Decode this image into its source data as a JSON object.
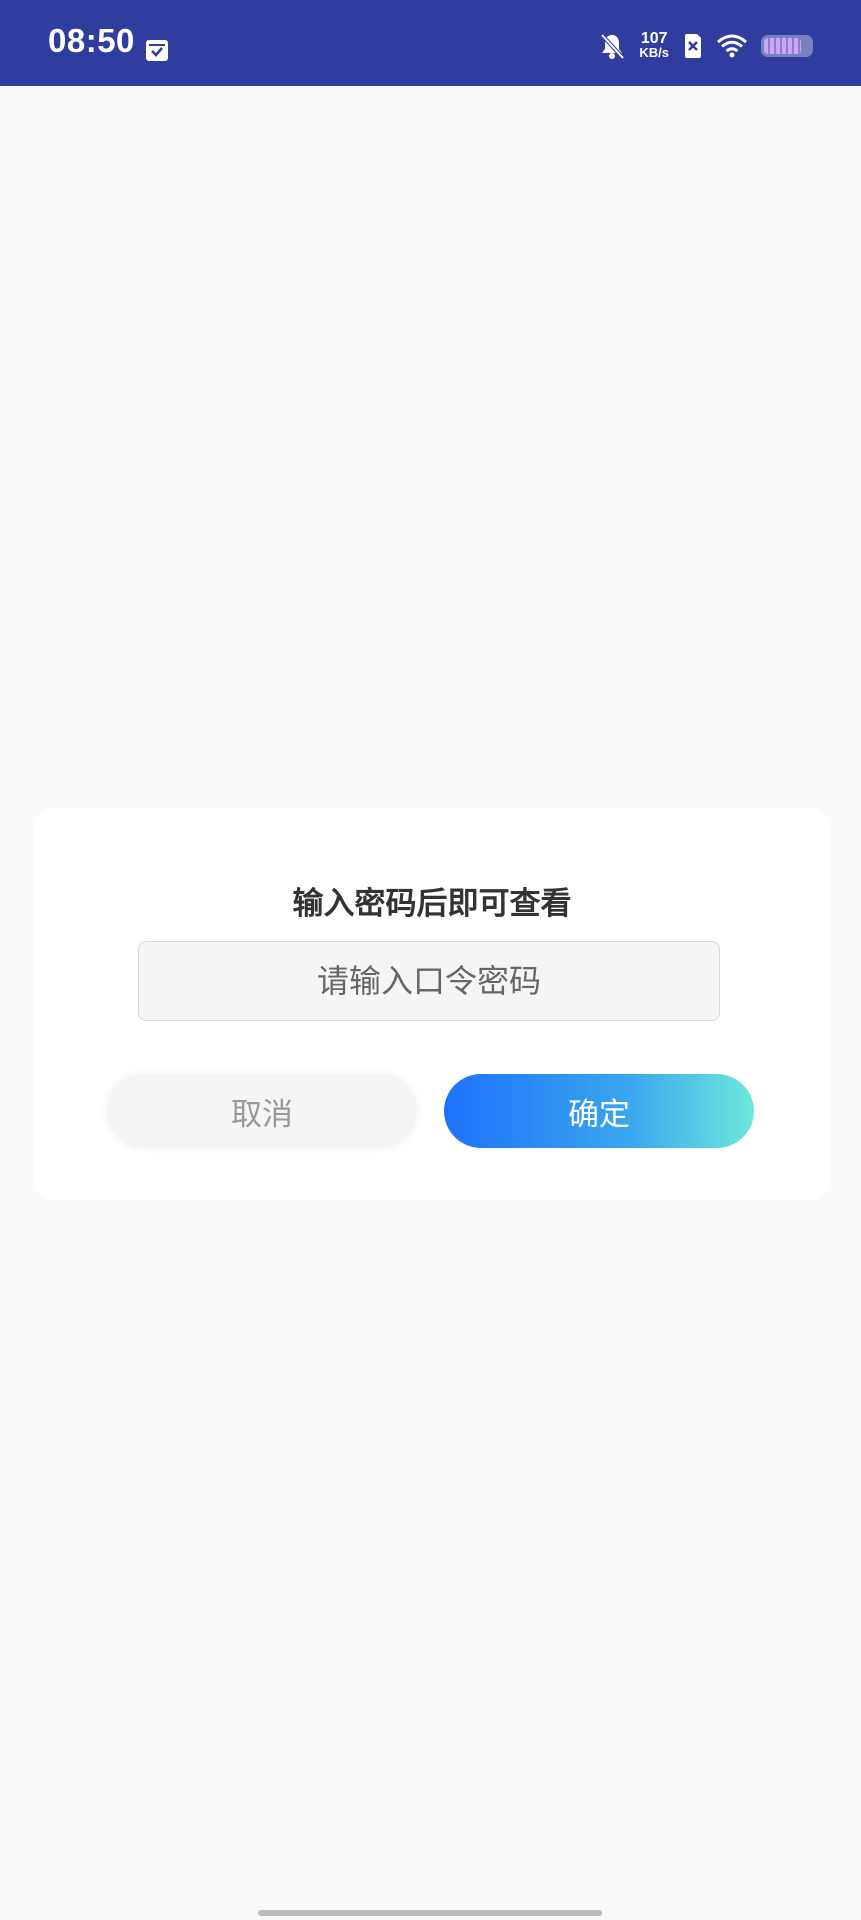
{
  "status_bar": {
    "time": "08:50",
    "net_speed_value": "107",
    "net_speed_unit": "KB/s",
    "battery_level": 0.8,
    "icons": [
      "calendar-check-icon",
      "bell-off-icon",
      "sim-x-icon",
      "wifi-icon",
      "battery-icon"
    ]
  },
  "dialog": {
    "title": "输入密码后即可查看",
    "password_placeholder": "请输入口令密码",
    "cancel_label": "取消",
    "confirm_label": "确定"
  },
  "colors": {
    "status_bar_bg": "#2f3e9e",
    "confirm_gradient_start": "#1d72fb",
    "confirm_gradient_end": "#6ee8dc",
    "page_bg": "#f9f9f9"
  }
}
